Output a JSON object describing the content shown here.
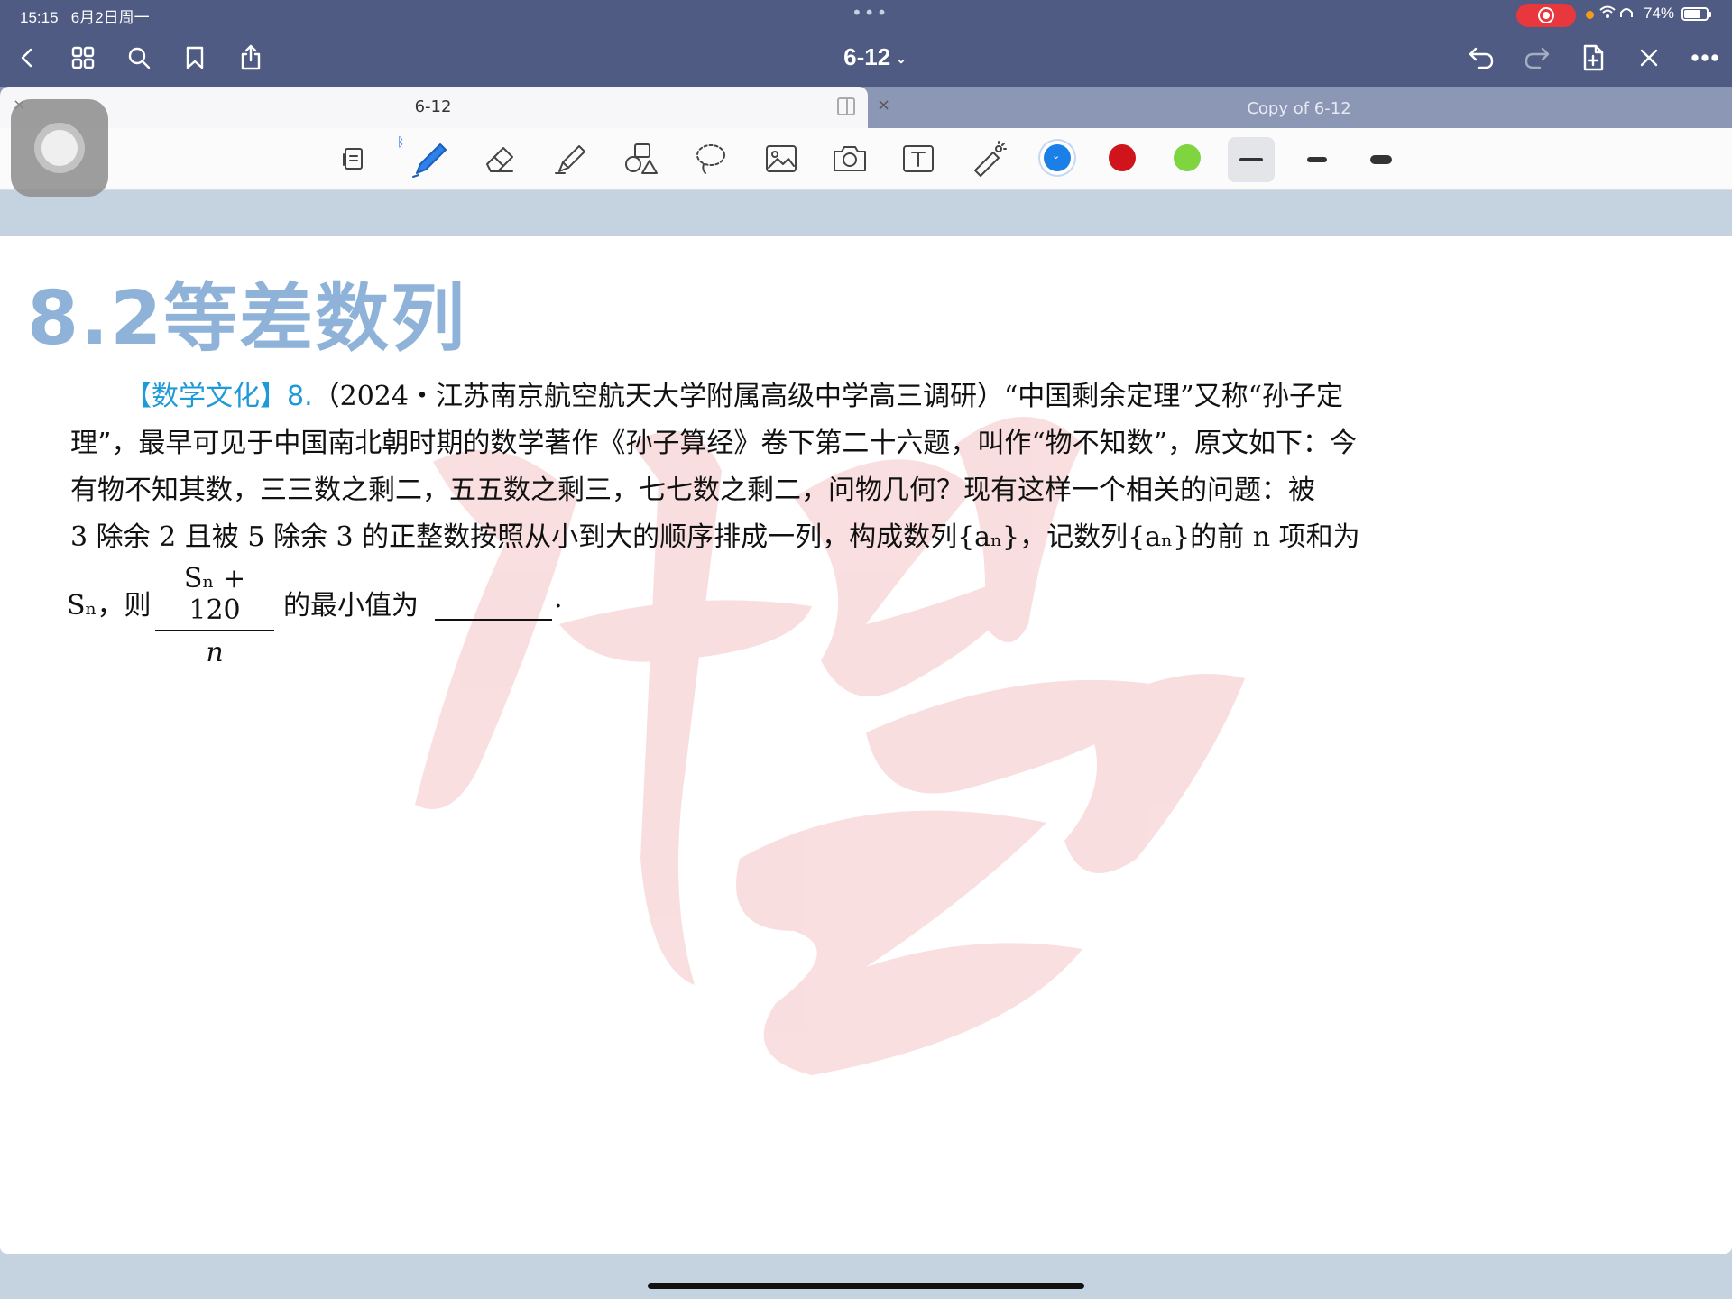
{
  "status_bar": {
    "time": "15:15",
    "date": "6月2日周一",
    "battery": "74%",
    "battery_level": 0.74
  },
  "nav": {
    "doc_title": "6-12",
    "icons": [
      "back-icon",
      "grid-icon",
      "search-icon",
      "bookmark-icon",
      "share-icon",
      "undo-icon",
      "redo-icon",
      "add-page-icon",
      "close-icon",
      "more-icon"
    ]
  },
  "tabs": [
    {
      "label": "6-12",
      "active": true
    },
    {
      "label": "Copy of 6-12",
      "active": false
    }
  ],
  "toolbar": {
    "tools": [
      "reader-icon",
      "pen-icon",
      "eraser-icon",
      "highlighter-icon",
      "shapes-icon",
      "lasso-icon",
      "image-icon",
      "camera-icon",
      "text-icon",
      "laser-pointer-icon"
    ],
    "colors": [
      {
        "name": "blue",
        "hex": "#1a7fe6",
        "selected": true
      },
      {
        "name": "red",
        "hex": "#d0141b",
        "selected": false
      },
      {
        "name": "green",
        "hex": "#7fd540",
        "selected": false
      }
    ],
    "stroke_widths": [
      "thin",
      "medium",
      "thick"
    ],
    "selected_stroke": "thin"
  },
  "page": {
    "heading": "8.2等差数列",
    "tag": "【数学文化】8.",
    "lines": [
      "（2024・江苏南京航空航天大学附属高级中学高三调研）“中国剩余定理”又称“孙子定",
      "理”，最早可见于中国南北朝时期的数学著作《孙子算经》卷下第二十六题，叫作“物不知数”，原文如下：今",
      "有物不知其数，三三数之剩二，五五数之剩三，七七数之剩二，问物几何？现有这样一个相关的问题：被",
      "3 除余 2 且被 5 除余 3 的正整数按照从小到大的顺序排成一列，构成数列{aₙ}，记数列{aₙ}的前 n 项和为"
    ],
    "last_line_prefix": "Sₙ，则",
    "fraction_numerator": "Sₙ + 120",
    "fraction_denominator": "n",
    "last_line_suffix": "的最小值为",
    "last_line_end": "."
  }
}
